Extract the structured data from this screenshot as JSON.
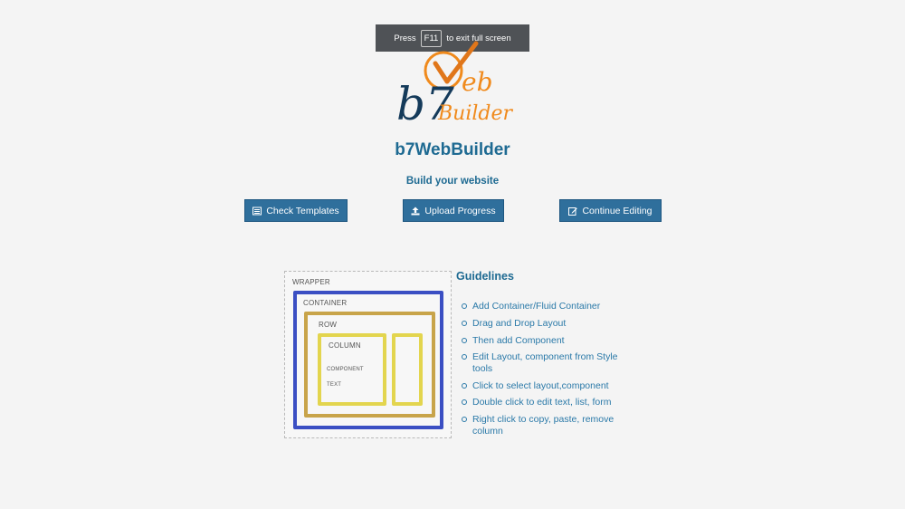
{
  "fullscreen_notice": {
    "press": "Press",
    "key": "F11",
    "suffix": "to exit full screen"
  },
  "logo": {
    "text_b": "b",
    "text_7": "7",
    "text_eb": "eb",
    "text_builder": "Builder"
  },
  "app_title": "b7WebBuilder",
  "subtitle": "Build your website",
  "buttons": {
    "check_templates": "Check Templates",
    "upload_progress": "Upload Progress",
    "continue_editing": "Continue Editing"
  },
  "diagram": {
    "wrapper": "WRAPPER",
    "container": "CONTAINER",
    "row": "ROW",
    "column": "COLUMN",
    "component": "COMPONENT",
    "text": "TEXT"
  },
  "guidelines": {
    "title": "Guidelines",
    "items": [
      "Add Container/Fluid Container",
      "Drag and Drop Layout",
      "Then add Component",
      "Edit Layout, component from Style tools",
      "Click to select layout,component",
      "Double click to edit text, list, form",
      "Right click to copy, paste, remove column"
    ]
  },
  "colors": {
    "background": "#f4f4f4",
    "primary_text": "#1e6a92",
    "button": "#2f6f9c",
    "logo_orange": "#f08a1c",
    "logo_dark": "#143a5a"
  }
}
